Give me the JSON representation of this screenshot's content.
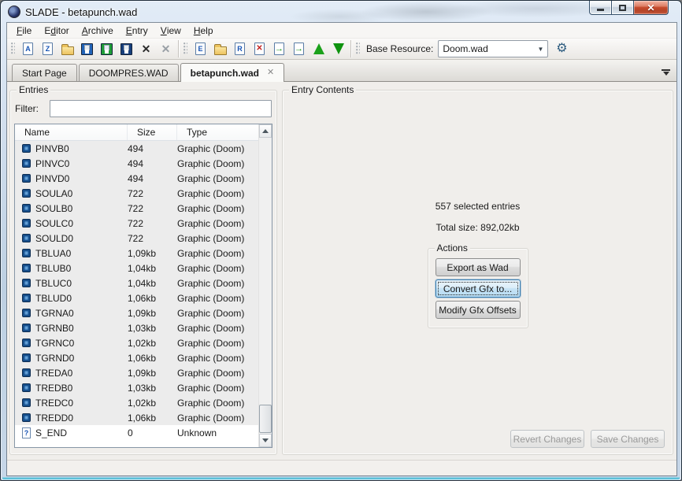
{
  "window": {
    "title": "SLADE - betapunch.wad",
    "controls": [
      "minimize",
      "maximize",
      "close"
    ]
  },
  "menu": {
    "items": [
      {
        "label": "File",
        "underline": 0
      },
      {
        "label": "Editor",
        "underline": 1
      },
      {
        "label": "Archive",
        "underline": 0
      },
      {
        "label": "Entry",
        "underline": 0
      },
      {
        "label": "View",
        "underline": 0
      },
      {
        "label": "Help",
        "underline": 0
      }
    ]
  },
  "toolbar": {
    "groups": [
      [
        {
          "name": "new-wad-icon",
          "kind": "doc",
          "glyph": "A"
        },
        {
          "name": "new-zip-icon",
          "kind": "doc",
          "glyph": "Z"
        },
        {
          "name": "open-archive-icon",
          "kind": "folder-open",
          "glyph": ""
        },
        {
          "name": "save-icon",
          "kind": "floppy",
          "variant": "blue",
          "glyph": ""
        },
        {
          "name": "save-as-icon",
          "kind": "floppy",
          "variant": "green",
          "glyph": ""
        },
        {
          "name": "save-all-icon",
          "kind": "floppy",
          "variant": "dark",
          "glyph": ""
        },
        {
          "name": "close-icon",
          "kind": "x",
          "variant": "black",
          "glyph": "✕"
        },
        {
          "name": "close-all-icon",
          "kind": "x",
          "variant": "gray",
          "glyph": "✕"
        }
      ],
      [
        {
          "name": "new-entry-icon",
          "kind": "doc",
          "glyph": "E"
        },
        {
          "name": "new-directory-icon",
          "kind": "folder",
          "glyph": ""
        },
        {
          "name": "rename-entry-icon",
          "kind": "doc",
          "glyph": "R"
        },
        {
          "name": "delete-entry-icon",
          "kind": "doc-x",
          "glyph": "✕"
        },
        {
          "name": "import-entry-icon",
          "kind": "doc-arrow-in",
          "glyph": "→"
        },
        {
          "name": "export-entry-icon",
          "kind": "doc-arrow-out",
          "glyph": "→"
        },
        {
          "name": "move-up-icon",
          "kind": "arrow-up",
          "glyph": ""
        },
        {
          "name": "move-down-icon",
          "kind": "arrow-down",
          "glyph": ""
        }
      ]
    ],
    "base_resource_label": "Base Resource:",
    "base_resource_value": "Doom.wad"
  },
  "tabs": [
    {
      "label": "Start Page",
      "active": false,
      "close": false
    },
    {
      "label": "DOOMPRES.WAD",
      "active": false,
      "close": false
    },
    {
      "label": "betapunch.wad",
      "active": true,
      "close": true
    }
  ],
  "entries_panel": {
    "title": "Entries",
    "filter_label": "Filter:",
    "filter_value": "",
    "columns": [
      "Name",
      "Size",
      "Type"
    ],
    "rows": [
      {
        "name": "PINVB0",
        "size": "494",
        "type": "Graphic (Doom)",
        "icon": "gfx",
        "selected": true
      },
      {
        "name": "PINVC0",
        "size": "494",
        "type": "Graphic (Doom)",
        "icon": "gfx",
        "selected": true
      },
      {
        "name": "PINVD0",
        "size": "494",
        "type": "Graphic (Doom)",
        "icon": "gfx",
        "selected": true
      },
      {
        "name": "SOULA0",
        "size": "722",
        "type": "Graphic (Doom)",
        "icon": "gfx",
        "selected": true
      },
      {
        "name": "SOULB0",
        "size": "722",
        "type": "Graphic (Doom)",
        "icon": "gfx",
        "selected": true
      },
      {
        "name": "SOULC0",
        "size": "722",
        "type": "Graphic (Doom)",
        "icon": "gfx",
        "selected": true
      },
      {
        "name": "SOULD0",
        "size": "722",
        "type": "Graphic (Doom)",
        "icon": "gfx",
        "selected": true
      },
      {
        "name": "TBLUA0",
        "size": "1,09kb",
        "type": "Graphic (Doom)",
        "icon": "gfx",
        "selected": true
      },
      {
        "name": "TBLUB0",
        "size": "1,04kb",
        "type": "Graphic (Doom)",
        "icon": "gfx",
        "selected": true
      },
      {
        "name": "TBLUC0",
        "size": "1,04kb",
        "type": "Graphic (Doom)",
        "icon": "gfx",
        "selected": true
      },
      {
        "name": "TBLUD0",
        "size": "1,06kb",
        "type": "Graphic (Doom)",
        "icon": "gfx",
        "selected": true
      },
      {
        "name": "TGRNA0",
        "size": "1,09kb",
        "type": "Graphic (Doom)",
        "icon": "gfx",
        "selected": true
      },
      {
        "name": "TGRNB0",
        "size": "1,03kb",
        "type": "Graphic (Doom)",
        "icon": "gfx",
        "selected": true
      },
      {
        "name": "TGRNC0",
        "size": "1,02kb",
        "type": "Graphic (Doom)",
        "icon": "gfx",
        "selected": true
      },
      {
        "name": "TGRND0",
        "size": "1,06kb",
        "type": "Graphic (Doom)",
        "icon": "gfx",
        "selected": true
      },
      {
        "name": "TREDA0",
        "size": "1,09kb",
        "type": "Graphic (Doom)",
        "icon": "gfx",
        "selected": true
      },
      {
        "name": "TREDB0",
        "size": "1,03kb",
        "type": "Graphic (Doom)",
        "icon": "gfx",
        "selected": true
      },
      {
        "name": "TREDC0",
        "size": "1,02kb",
        "type": "Graphic (Doom)",
        "icon": "gfx",
        "selected": true
      },
      {
        "name": "TREDD0",
        "size": "1,06kb",
        "type": "Graphic (Doom)",
        "icon": "gfx",
        "selected": true
      },
      {
        "name": "S_END",
        "size": "0",
        "type": "Unknown",
        "icon": "unknown",
        "selected": false
      }
    ]
  },
  "contents_panel": {
    "title": "Entry Contents",
    "selected_text": "557 selected entries",
    "total_size_text": "Total size: 892,02kb",
    "actions": {
      "title": "Actions",
      "buttons": [
        "Export as Wad",
        "Convert Gfx to...",
        "Modify Gfx Offsets"
      ]
    },
    "footer_buttons": [
      "Revert Changes",
      "Save Changes"
    ]
  }
}
